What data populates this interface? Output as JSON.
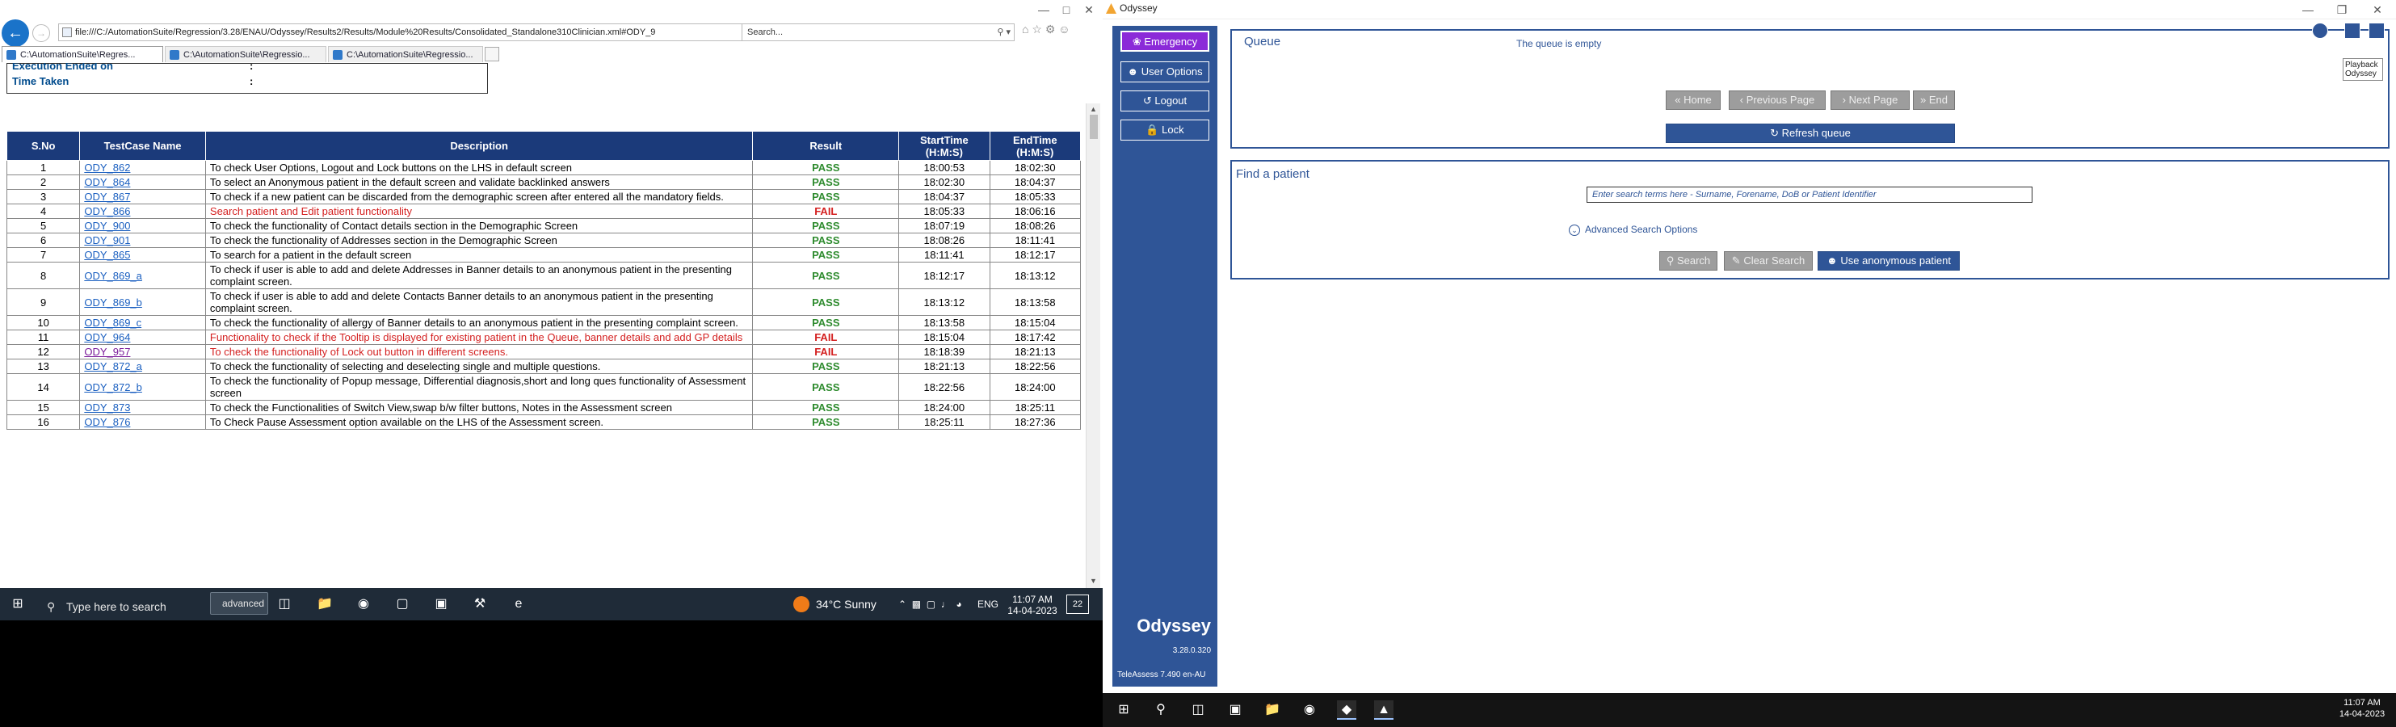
{
  "ie": {
    "address": "file:///C:/AutomationSuite/Regression/3.28/ENAU/Odyssey/Results2/Results/Module%20Results/Consolidated_Standalone310Clinician.xml#ODY_9",
    "search_placeholder": "Search...",
    "tabs": [
      "C:\\AutomationSuite\\Regres...",
      "C:\\AutomationSuite\\Regressio...",
      "C:\\AutomationSuite\\Regressio..."
    ],
    "summary": {
      "row1": "Execution Ended on",
      "row2": "Time Taken",
      "colon": ":"
    },
    "table": {
      "headers": [
        "S.No",
        "TestCase Name",
        "Description",
        "Result",
        "StartTime\n(H:M:S)",
        "EndTime\n(H:M:S)"
      ],
      "header_start_1": "StartTime",
      "header_start_2": "(H:M:S)",
      "header_end_1": "EndTime",
      "header_end_2": "(H:M:S)",
      "rows": [
        {
          "sno": "1",
          "name": "ODY_862",
          "desc": "To check User Options, Logout and Lock buttons on the LHS in default screen",
          "result": "PASS",
          "start": "18:00:53",
          "end": "18:02:30"
        },
        {
          "sno": "2",
          "name": "ODY_864",
          "desc": "To select an Anonymous patient in the default screen and validate backlinked answers",
          "result": "PASS",
          "start": "18:02:30",
          "end": "18:04:37"
        },
        {
          "sno": "3",
          "name": "ODY_867",
          "desc": "To check if a new patient can be discarded from the demographic screen after entered all the mandatory fields.",
          "result": "PASS",
          "start": "18:04:37",
          "end": "18:05:33"
        },
        {
          "sno": "4",
          "name": "ODY_866",
          "desc": "Search patient and Edit patient functionality",
          "result": "FAIL",
          "start": "18:05:33",
          "end": "18:06:16"
        },
        {
          "sno": "5",
          "name": "ODY_900",
          "desc": "To check the functionality of Contact details section in the Demographic Screen",
          "result": "PASS",
          "start": "18:07:19",
          "end": "18:08:26"
        },
        {
          "sno": "6",
          "name": "ODY_901",
          "desc": "To check the functionality of Addresses section in the Demographic Screen",
          "result": "PASS",
          "start": "18:08:26",
          "end": "18:11:41"
        },
        {
          "sno": "7",
          "name": "ODY_865",
          "desc": "To search for a patient in the default screen",
          "result": "PASS",
          "start": "18:11:41",
          "end": "18:12:17"
        },
        {
          "sno": "8",
          "name": "ODY_869_a",
          "desc": "To check if user is able to add and delete Addresses in Banner details to an anonymous patient in the presenting complaint screen.",
          "result": "PASS",
          "start": "18:12:17",
          "end": "18:13:12"
        },
        {
          "sno": "9",
          "name": "ODY_869_b",
          "desc": "To check if user is able to add and delete Contacts Banner details to an anonymous patient in the presenting complaint screen.",
          "result": "PASS",
          "start": "18:13:12",
          "end": "18:13:58"
        },
        {
          "sno": "10",
          "name": "ODY_869_c",
          "desc": "To check the functionality of allergy of Banner details to an anonymous patient in the presenting complaint screen.",
          "result": "PASS",
          "start": "18:13:58",
          "end": "18:15:04"
        },
        {
          "sno": "11",
          "name": "ODY_964",
          "desc": "Functionality to check if the Tooltip is displayed for existing patient in the Queue, banner details and add GP details",
          "result": "FAIL",
          "start": "18:15:04",
          "end": "18:17:42"
        },
        {
          "sno": "12",
          "name": "ODY_957",
          "desc": "To check the functionality of Lock out button in different screens.",
          "result": "FAIL",
          "start": "18:18:39",
          "end": "18:21:13"
        },
        {
          "sno": "13",
          "name": "ODY_872_a",
          "desc": "To check the functionality of selecting and deselecting single and multiple questions.",
          "result": "PASS",
          "start": "18:21:13",
          "end": "18:22:56"
        },
        {
          "sno": "14",
          "name": "ODY_872_b",
          "desc": "To check the functionality of Popup message, Differential diagnosis,short and long ques functionality of Assessment screen",
          "result": "PASS",
          "start": "18:22:56",
          "end": "18:24:00"
        },
        {
          "sno": "15",
          "name": "ODY_873",
          "desc": "To check the Functionalities of Switch View,swap b/w filter buttons, Notes in the Assessment screen",
          "result": "PASS",
          "start": "18:24:00",
          "end": "18:25:11"
        },
        {
          "sno": "16",
          "name": "ODY_876",
          "desc": "To Check Pause Assessment option available on the LHS of the Assessment screen.",
          "result": "PASS",
          "start": "18:25:11",
          "end": "18:27:36"
        }
      ]
    }
  },
  "taskbar_left": {
    "search_placeholder": "Type here to search",
    "advanced_label": "advanced",
    "weather": "34°C  Sunny",
    "lang": "ENG",
    "time": "11:07 AM",
    "date": "14-04-2023",
    "notifications": "22"
  },
  "odyssey": {
    "window_title": "Odyssey",
    "sidebar": {
      "emergency": "Emergency",
      "user_options": "User Options",
      "logout": "Logout",
      "lock": "Lock",
      "brand": "Odyssey",
      "version": "3.28.0.320",
      "teleassess": "TeleAssess 7.490 en-AU"
    },
    "queue": {
      "title": "Queue",
      "empty_msg": "The queue is empty",
      "home": "Home",
      "previous": "Previous Page",
      "next": "Next Page",
      "end": "End",
      "refresh": "Refresh queue"
    },
    "patient": {
      "title": "Find a patient",
      "search_placeholder": "Enter search terms here - Surname, Forename, DoB or Patient Identifier",
      "advanced": "Advanced Search Options",
      "search": "Search",
      "clear": "Clear Search",
      "anonymous": "Use anonymous patient"
    },
    "playback": "Playback",
    "playback_sub": "Odyssey"
  },
  "taskbar_right": {
    "time": "11:07 AM",
    "date": "14-04-2023"
  }
}
